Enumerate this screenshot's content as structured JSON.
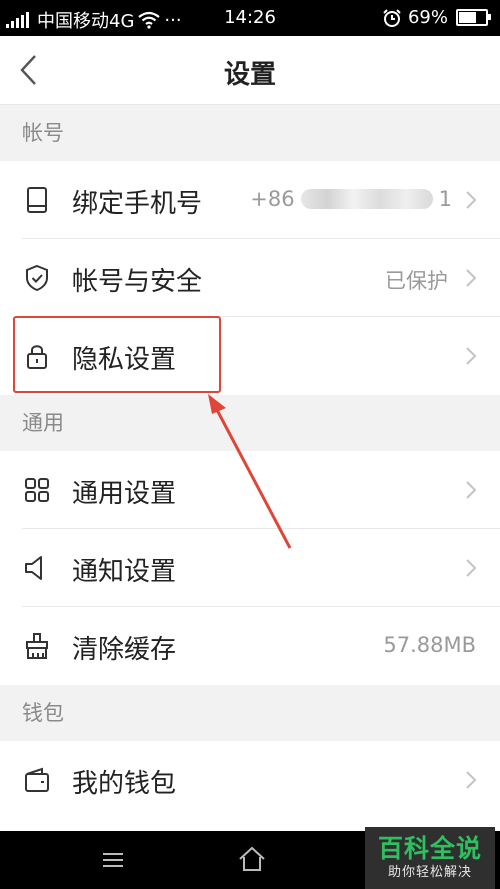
{
  "status_bar": {
    "carrier": "中国移动4G",
    "dots": "···",
    "time": "14:26",
    "battery": "69%",
    "battery_level": 0.69
  },
  "header": {
    "title": "设置"
  },
  "sections": {
    "account": "帐号",
    "general": "通用",
    "wallet": "钱包"
  },
  "rows": {
    "bind_phone": {
      "label": "绑定手机号",
      "value_prefix": "+86",
      "value_suffix": "1"
    },
    "account_security": {
      "label": "帐号与安全",
      "value": "已保护"
    },
    "privacy": {
      "label": "隐私设置"
    },
    "general_settings": {
      "label": "通用设置"
    },
    "notification_settings": {
      "label": "通知设置"
    },
    "clear_cache": {
      "label": "清除缓存",
      "value": "57.88MB"
    },
    "my_wallet": {
      "label": "我的钱包"
    }
  },
  "watermark": {
    "title": "百科全说",
    "subtitle": "助你轻松解决"
  },
  "colors": {
    "annotation": "#e0453a",
    "watermark_green": "#2fbf5f"
  },
  "icons": [
    "back-arrow-icon",
    "phone-icon",
    "shield-icon",
    "lock-icon",
    "grid-icon",
    "speaker-icon",
    "broom-icon",
    "wallet-icon",
    "chevron-right-icon",
    "menu-icon",
    "home-icon",
    "wifi-icon",
    "alarm-icon",
    "battery-icon",
    "signal-icon"
  ]
}
